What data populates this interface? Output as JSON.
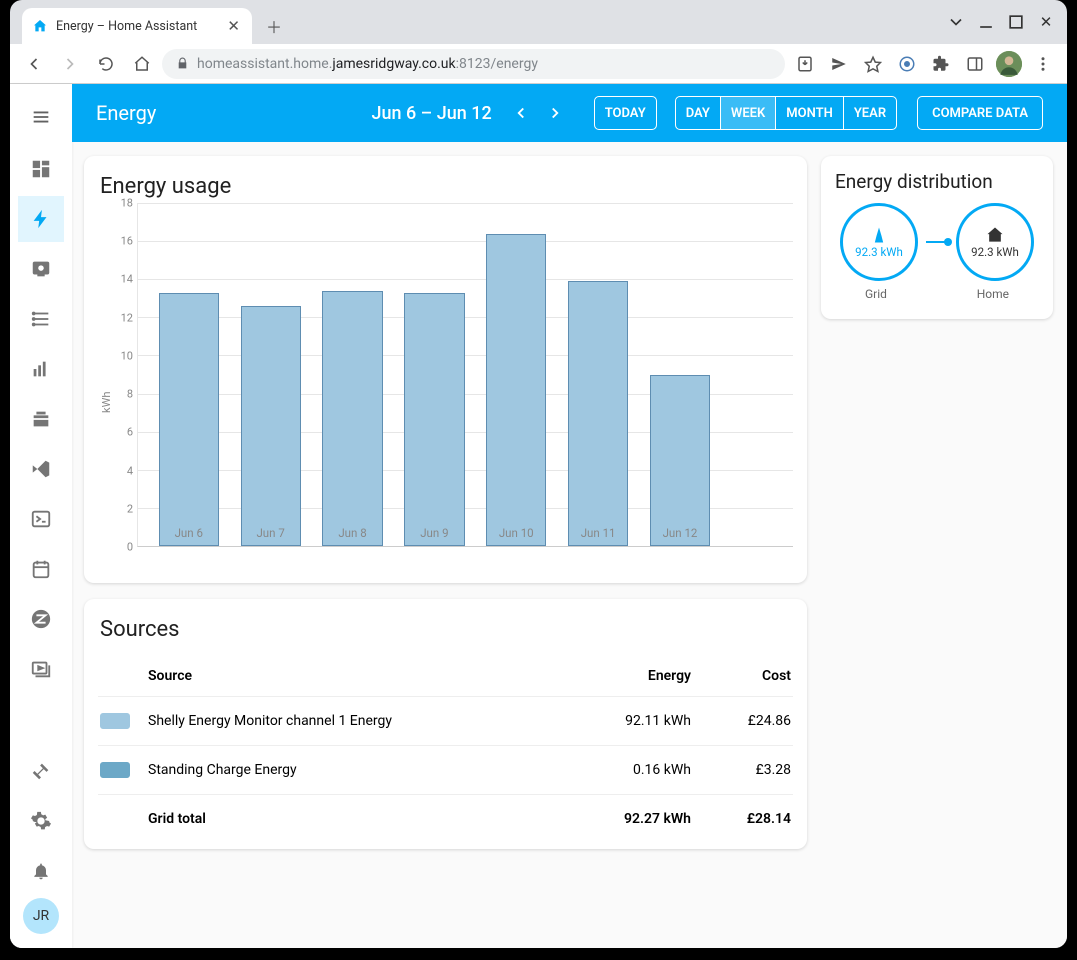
{
  "browser": {
    "tab_title": "Energy – Home Assistant",
    "url_prefix": "homeassistant.home.",
    "url_host": "jamesridgway.co.uk",
    "url_port_path": ":8123/energy"
  },
  "header": {
    "title": "Energy",
    "date_range": "Jun 6 – Jun 12",
    "periods": {
      "today": "TODAY",
      "day": "DAY",
      "week": "WEEK",
      "month": "MONTH",
      "year": "YEAR"
    },
    "compare": "COMPARE DATA"
  },
  "usage": {
    "title": "Energy usage"
  },
  "chart_data": {
    "type": "bar",
    "categories": [
      "Jun 6",
      "Jun 7",
      "Jun 8",
      "Jun 9",
      "Jun 10",
      "Jun 11",
      "Jun 12"
    ],
    "values": [
      13.3,
      12.6,
      13.4,
      13.3,
      16.4,
      13.9,
      9.0
    ],
    "ylabel": "kWh",
    "yticks": [
      0,
      2,
      4,
      6,
      8,
      10,
      12,
      14,
      16,
      18
    ],
    "ylim": [
      0,
      18
    ]
  },
  "sources": {
    "title": "Sources",
    "headers": {
      "source": "Source",
      "energy": "Energy",
      "cost": "Cost"
    },
    "rows": [
      {
        "swatch": "#9fc7e0",
        "name": "Shelly Energy Monitor channel 1 Energy",
        "energy": "92.11 kWh",
        "cost": "£24.86"
      },
      {
        "swatch": "#6ca8c7",
        "name": "Standing Charge Energy",
        "energy": "0.16 kWh",
        "cost": "£3.28"
      }
    ],
    "total": {
      "name": "Grid total",
      "energy": "92.27 kWh",
      "cost": "£28.14"
    }
  },
  "distribution": {
    "title": "Energy distribution",
    "grid_value": "92.3 kWh",
    "home_value": "92.3 kWh",
    "grid_label": "Grid",
    "home_label": "Home"
  },
  "sidebar_user": "JR"
}
